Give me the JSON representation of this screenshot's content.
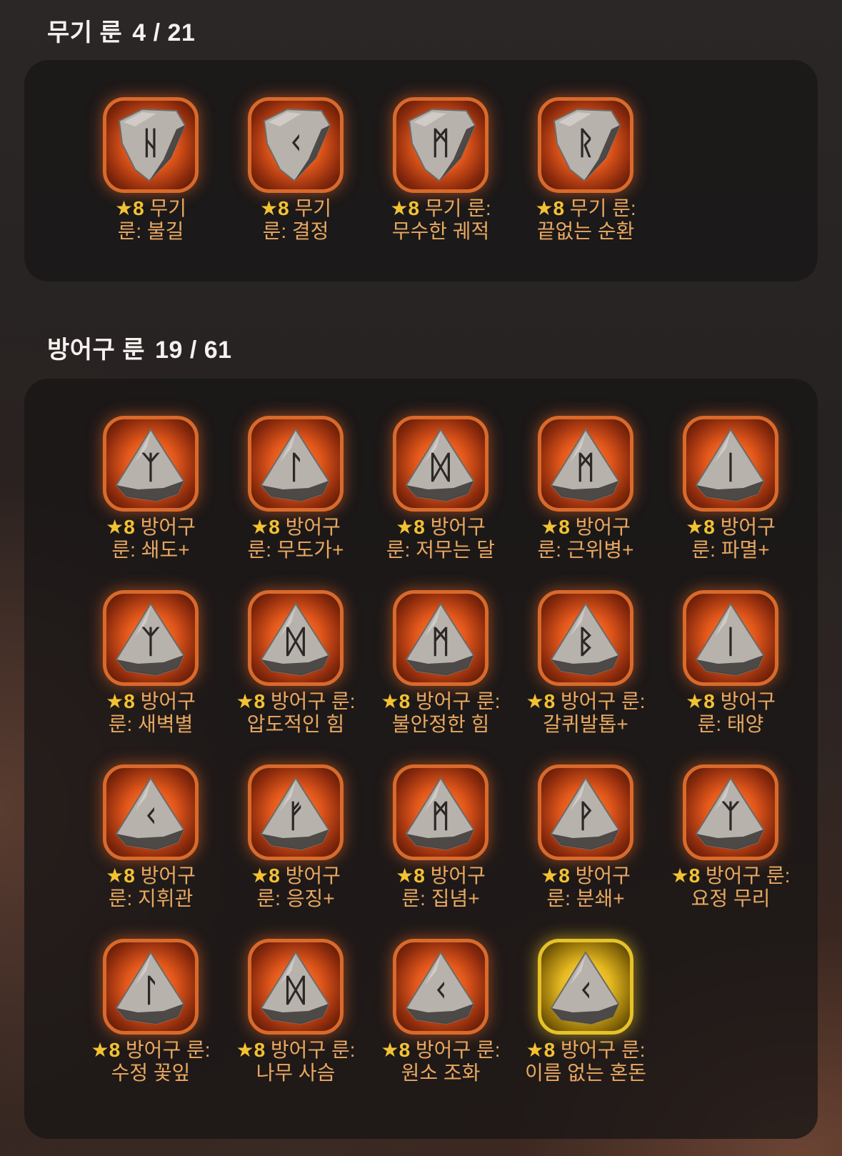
{
  "weapon": {
    "title": "무기 룬",
    "count": "4 / 21",
    "items": [
      {
        "star": "★",
        "grade": "8",
        "line1": " 무기",
        "line2": "룬: 불길",
        "glyph": "ᚺ",
        "shape": "shield",
        "frame": "orange"
      },
      {
        "star": "★",
        "grade": "8",
        "line1": " 무기",
        "line2": "룬: 결정",
        "glyph": "ᚲ",
        "shape": "shield",
        "frame": "orange"
      },
      {
        "star": "★",
        "grade": "8",
        "line1": " 무기 룬:",
        "line2": "무수한 궤적",
        "glyph": "ᛗ",
        "shape": "shield",
        "frame": "orange"
      },
      {
        "star": "★",
        "grade": "8",
        "line1": " 무기 룬:",
        "line2": "끝없는 순환",
        "glyph": "ᚱ",
        "shape": "shield",
        "frame": "orange"
      }
    ]
  },
  "armor": {
    "title": "방어구 룬",
    "count": "19 / 61",
    "items": [
      {
        "star": "★",
        "grade": "8",
        "line1": " 방어구",
        "line2": "룬: 쇄도+",
        "glyph": "ᛉ",
        "shape": "pyramid",
        "frame": "orange"
      },
      {
        "star": "★",
        "grade": "8",
        "line1": " 방어구",
        "line2": "룬: 무도가+",
        "glyph": "ᛚ",
        "shape": "pyramid",
        "frame": "orange"
      },
      {
        "star": "★",
        "grade": "8",
        "line1": " 방어구",
        "line2": "룬: 저무는 달",
        "glyph": "ᛞ",
        "shape": "pyramid",
        "frame": "orange"
      },
      {
        "star": "★",
        "grade": "8",
        "line1": " 방어구",
        "line2": "룬: 근위병+",
        "glyph": "ᛗ",
        "shape": "pyramid",
        "frame": "orange"
      },
      {
        "star": "★",
        "grade": "8",
        "line1": " 방어구",
        "line2": "룬: 파멸+",
        "glyph": "ᛁ",
        "shape": "pyramid",
        "frame": "orange"
      },
      {
        "star": "★",
        "grade": "8",
        "line1": " 방어구",
        "line2": "룬: 새벽별",
        "glyph": "ᛉ",
        "shape": "pyramid",
        "frame": "orange"
      },
      {
        "star": "★",
        "grade": "8",
        "line1": " 방어구 룬:",
        "line2": "압도적인 힘",
        "glyph": "ᛞ",
        "shape": "pyramid",
        "frame": "orange"
      },
      {
        "star": "★",
        "grade": "8",
        "line1": " 방어구 룬:",
        "line2": "불안정한 힘",
        "glyph": "ᛗ",
        "shape": "pyramid",
        "frame": "orange"
      },
      {
        "star": "★",
        "grade": "8",
        "line1": " 방어구 룬:",
        "line2": "갈퀴발톱+",
        "glyph": "ᛒ",
        "shape": "pyramid",
        "frame": "orange"
      },
      {
        "star": "★",
        "grade": "8",
        "line1": " 방어구",
        "line2": "룬: 태양",
        "glyph": "ᛁ",
        "shape": "pyramid",
        "frame": "orange"
      },
      {
        "star": "★",
        "grade": "8",
        "line1": " 방어구",
        "line2": "룬: 지휘관",
        "glyph": "ᚲ",
        "shape": "pyramid",
        "frame": "orange"
      },
      {
        "star": "★",
        "grade": "8",
        "line1": " 방어구",
        "line2": "룬: 응징+",
        "glyph": "ᚠ",
        "shape": "pyramid",
        "frame": "orange"
      },
      {
        "star": "★",
        "grade": "8",
        "line1": " 방어구",
        "line2": "룬: 집념+",
        "glyph": "ᛗ",
        "shape": "pyramid",
        "frame": "orange"
      },
      {
        "star": "★",
        "grade": "8",
        "line1": " 방어구",
        "line2": "룬: 분쇄+",
        "glyph": "ᚹ",
        "shape": "pyramid",
        "frame": "orange"
      },
      {
        "star": "★",
        "grade": "8",
        "line1": " 방어구 룬:",
        "line2": "요정 무리",
        "glyph": "ᛉ",
        "shape": "pyramid",
        "frame": "orange"
      },
      {
        "star": "★",
        "grade": "8",
        "line1": " 방어구 룬:",
        "line2": "수정 꽃잎",
        "glyph": "ᛚ",
        "shape": "pyramid",
        "frame": "orange"
      },
      {
        "star": "★",
        "grade": "8",
        "line1": " 방어구 룬:",
        "line2": "나무 사슴",
        "glyph": "ᛞ",
        "shape": "pyramid",
        "frame": "orange"
      },
      {
        "star": "★",
        "grade": "8",
        "line1": " 방어구 룬:",
        "line2": "원소 조화",
        "glyph": "ᚲ",
        "shape": "pyramid",
        "frame": "orange"
      },
      {
        "star": "★",
        "grade": "8",
        "line1": " 방어구 룬:",
        "line2": "이름 없는 혼돈",
        "glyph": "ᚲ",
        "shape": "pyramid",
        "frame": "gold"
      }
    ]
  },
  "colors": {
    "frame_orange": "#d96a2b",
    "frame_gold": "#e7c228",
    "label": "#e9a860",
    "star": "#f2c232"
  }
}
